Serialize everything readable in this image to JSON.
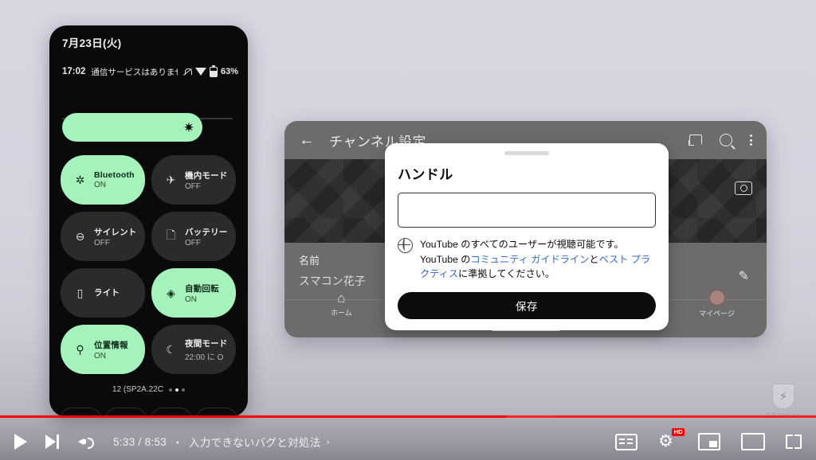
{
  "video_player": {
    "progress": {
      "played_percent": 62,
      "loaded_percent": 68,
      "chapter_count": 9
    },
    "controls": {
      "play_label": "play-button",
      "next_label": "next-video-button",
      "volume_label": "volume-button",
      "time_current": "5:33",
      "time_total": "8:53",
      "time_display": "5:33 / 8:53",
      "chapter_separator": "・",
      "chapter_title": "入力できないバグと対処法",
      "chapter_arrow": "›",
      "subtitles_label": "subtitles-button",
      "settings_label": "settings-button",
      "quality_badge": "HD",
      "miniplayer_label": "miniplayer-button",
      "theater_label": "theater-mode-button",
      "fullscreen_label": "fullscreen-button"
    }
  },
  "watermark": {
    "text": "コアコンシェル",
    "glyph": "⚡"
  },
  "phone_left": {
    "date": "7月23日(火)",
    "status": {
      "time": "17:02",
      "carrier": "通信サービスはありませ",
      "battery_percent": "63%",
      "bell_icon": "bell-muted-icon",
      "wifi_icon": "wifi-icon",
      "battery_icon": "battery-icon"
    },
    "brightness": {
      "icon": "brightness-icon",
      "glyph": "✷",
      "level_percent": 80
    },
    "tiles": [
      {
        "label": "Bluetooth",
        "state": "ON",
        "on": true,
        "icon": "bluetooth-icon",
        "glyph": "✲"
      },
      {
        "label": "機内モード",
        "state": "OFF",
        "on": false,
        "icon": "airplane-icon",
        "glyph": "✈"
      },
      {
        "label": "サイレント",
        "state": "OFF",
        "on": false,
        "icon": "do-not-disturb-icon",
        "glyph": "⊖"
      },
      {
        "label": "バッテリー",
        "state": "OFF",
        "on": false,
        "icon": "battery-saver-icon",
        "glyph": "🗋"
      },
      {
        "label": "ライト",
        "state": "",
        "on": false,
        "icon": "flashlight-icon",
        "glyph": "▯"
      },
      {
        "label": "自動回転",
        "state": "ON",
        "on": true,
        "icon": "auto-rotate-icon",
        "glyph": "◈"
      },
      {
        "label": "位置情報",
        "state": "ON",
        "on": true,
        "icon": "location-icon",
        "glyph": "⚲"
      },
      {
        "label": "夜間モード",
        "state": "22:00 に O",
        "on": false,
        "icon": "night-mode-icon",
        "glyph": "☾"
      }
    ],
    "footer_label": "12 (SP2A.22C",
    "page_dots": 3,
    "active_dot": 1,
    "actions": [
      {
        "name": "edit-tiles-button",
        "glyph": "✏"
      },
      {
        "name": "user-switch-button",
        "glyph": "👤"
      },
      {
        "name": "power-button",
        "glyph": "⏻"
      },
      {
        "name": "settings-button",
        "glyph": "⚙"
      }
    ]
  },
  "phone_right": {
    "topbar": {
      "back_icon": "back-arrow-icon",
      "back_glyph": "←",
      "title": "チャンネル設定",
      "cast_icon": "cast-icon",
      "search_icon": "search-icon",
      "menu_icon": "overflow-menu-icon"
    },
    "banner": {
      "camera_icon": "camera-icon"
    },
    "name_row": {
      "label": "名前",
      "value": "スマコン花子",
      "edit_icon": "pencil-icon",
      "edit_glyph": "✎"
    },
    "nav": [
      {
        "label": "ホーム",
        "icon": "home-icon",
        "glyph": "⌂"
      },
      {
        "label": "マイページ",
        "icon": "avatar-icon",
        "glyph": ""
      }
    ]
  },
  "dialog": {
    "grabber": "drag-handle",
    "title": "ハンドル",
    "input_value": "",
    "input_placeholder": "",
    "note": {
      "icon": "globe-icon",
      "line1": "YouTube のすべてのユーザーが視聴可能です。",
      "line2_pre": "YouTube の",
      "link1": "コミュニティ ガイドライン",
      "mid": "と",
      "link2": "ベスト プラクティス",
      "line2_post": "に準拠してください。"
    },
    "save_label": "保存"
  },
  "colors": {
    "accent_green": "#a6f2bd",
    "youtube_red": "#ff0000",
    "link_blue": "#3069c7",
    "dark_surface": "#2b2b2b"
  }
}
